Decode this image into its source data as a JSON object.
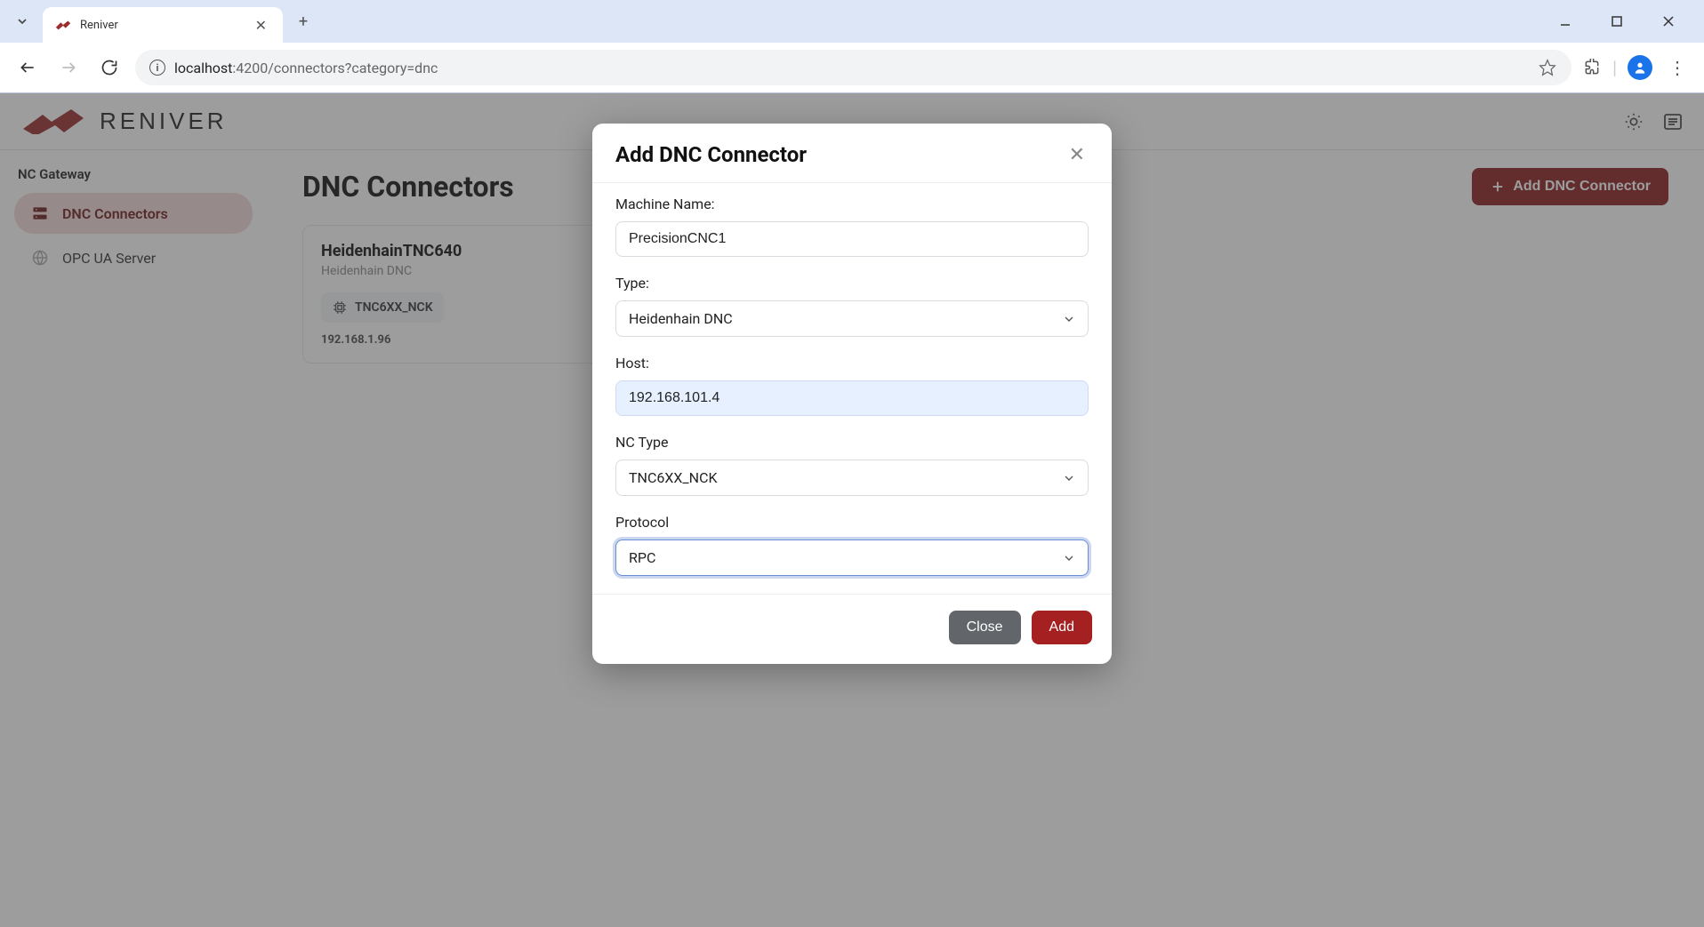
{
  "browser": {
    "tab_title": "Reniver",
    "url_host": "localhost",
    "url_port_path": ":4200/connectors?category=dnc"
  },
  "app": {
    "brand": "RENIVER"
  },
  "sidebar": {
    "section_title": "NC Gateway",
    "items": [
      {
        "label": "DNC Connectors",
        "active": true
      },
      {
        "label": "OPC UA Server",
        "active": false
      }
    ]
  },
  "main": {
    "title": "DNC Connectors",
    "add_button": "Add DNC Connector",
    "card": {
      "title": "HeidenhainTNC640",
      "subtitle": "Heidenhain DNC",
      "chip": "TNC6XX_NCK",
      "ip": "192.168.1.96"
    }
  },
  "modal": {
    "title": "Add DNC Connector",
    "fields": {
      "machine_name": {
        "label": "Machine Name:",
        "value": "PrecisionCNC1"
      },
      "type": {
        "label": "Type:",
        "value": "Heidenhain DNC"
      },
      "host": {
        "label": "Host:",
        "value": "192.168.101.4"
      },
      "nc_type": {
        "label": "NC Type",
        "value": "TNC6XX_NCK"
      },
      "protocol": {
        "label": "Protocol",
        "value": "RPC"
      }
    },
    "close_button": "Close",
    "add_button": "Add"
  }
}
